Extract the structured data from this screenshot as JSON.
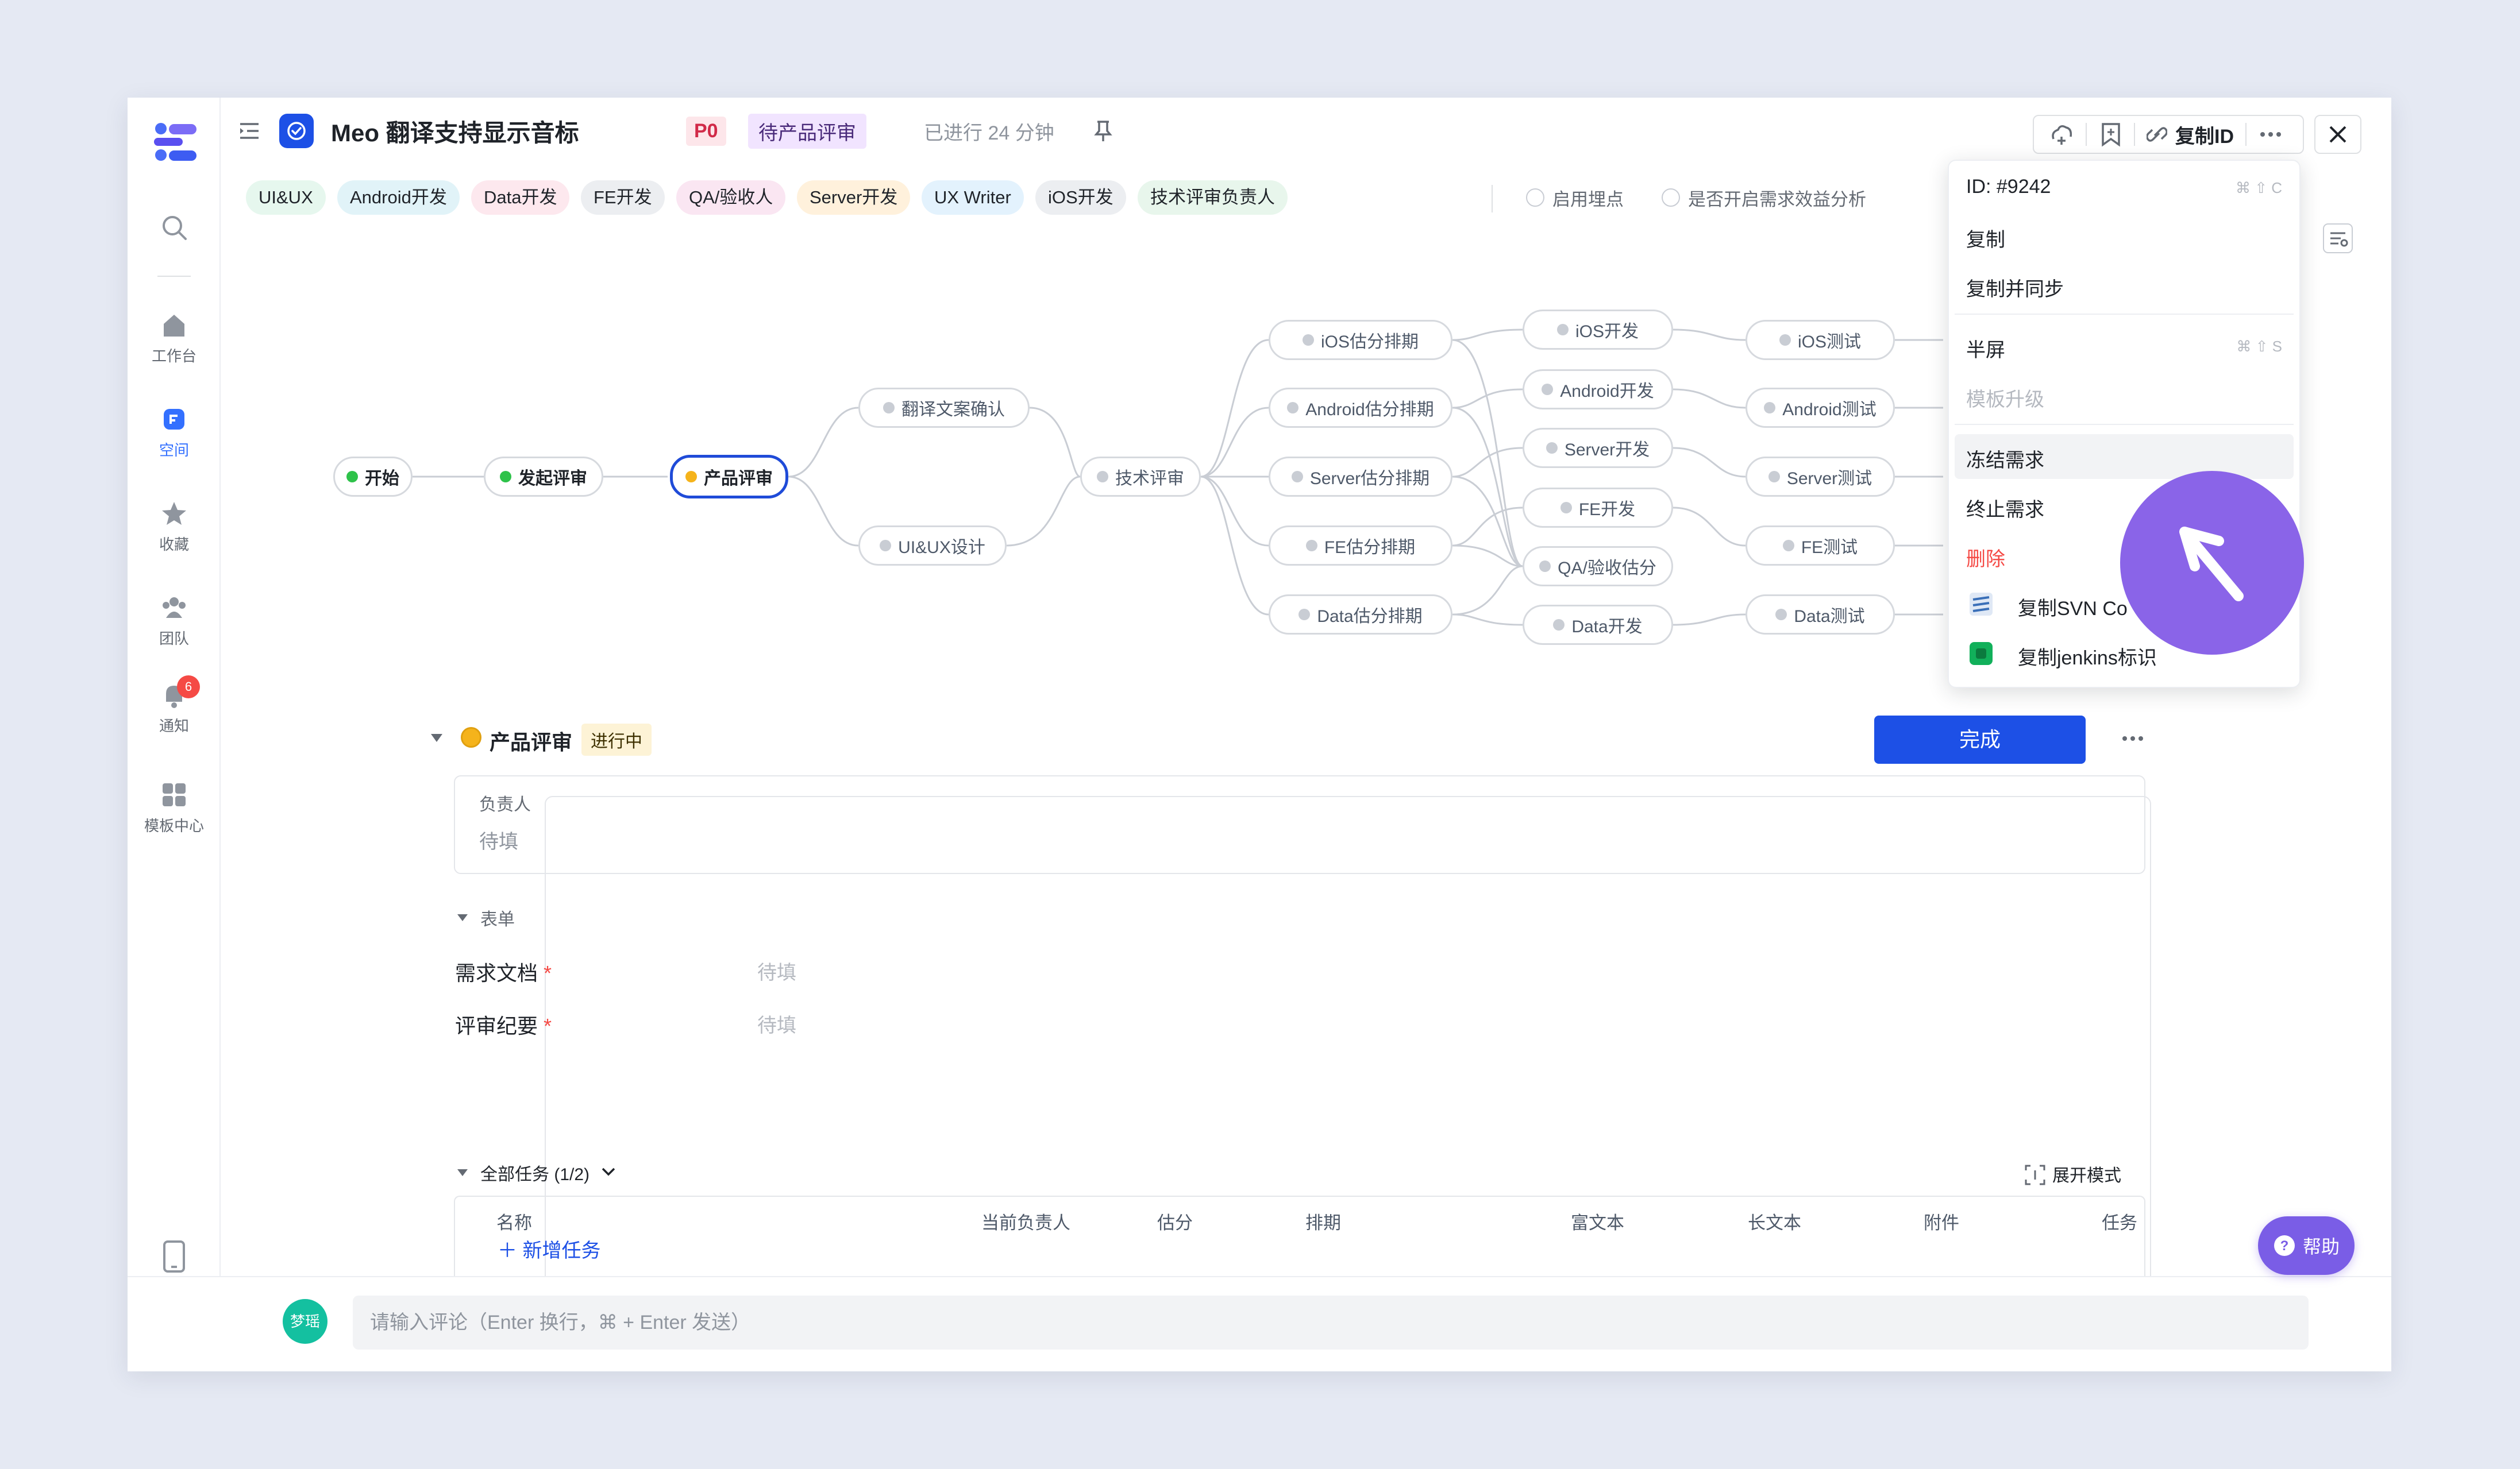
{
  "nav": {
    "items": [
      {
        "label": "工作台",
        "icon": "home-icon"
      },
      {
        "label": "空间",
        "icon": "space-icon"
      },
      {
        "label": "收藏",
        "icon": "star-icon"
      },
      {
        "label": "团队",
        "icon": "team-icon"
      },
      {
        "label": "通知",
        "icon": "bell-icon",
        "badge": "6"
      },
      {
        "label": "模板中心",
        "icon": "template-icon"
      }
    ],
    "user_avatar": "梦瑶"
  },
  "header": {
    "title": "Meo 翻译支持显示音标",
    "priority": "P0",
    "status": "待产品评审",
    "elapsed": "已进行 24 分钟",
    "copy_id_label": "复制ID"
  },
  "chips": [
    {
      "label": "UI&UX",
      "color": "#e6f7ee"
    },
    {
      "label": "Android开发",
      "color": "#e1f3f8"
    },
    {
      "label": "Data开发",
      "color": "#fde8ee"
    },
    {
      "label": "FE开发",
      "color": "#eceef1"
    },
    {
      "label": "QA/验收人",
      "color": "#fae6f2"
    },
    {
      "label": "Server开发",
      "color": "#fff1dc"
    },
    {
      "label": "UX Writer",
      "color": "#e3f2fd"
    },
    {
      "label": "iOS开发",
      "color": "#eceef1"
    },
    {
      "label": "技术评审负责人",
      "color": "#e8f6ec"
    }
  ],
  "toggles": [
    {
      "label": "启用埋点"
    },
    {
      "label": "是否开启需求效益分析"
    }
  ],
  "flow": {
    "nodes": {
      "start": "开始",
      "launch": "发起评审",
      "product": "产品评审",
      "copy_confirm": "翻译文案确认",
      "uiux": "UI&UX设计",
      "tech": "技术评审",
      "ios_est": "iOS估分排期",
      "android_est": "Android估分排期",
      "server_est": "Server估分排期",
      "fe_est": "FE估分排期",
      "data_est": "Data估分排期",
      "ios_dev": "iOS开发",
      "android_dev": "Android开发",
      "server_dev": "Server开发",
      "fe_dev": "FE开发",
      "qa_est": "QA/验收估分",
      "data_dev": "Data开发",
      "ios_test": "iOS测试",
      "android_test": "Android测试",
      "server_test": "Server测试",
      "fe_test": "FE测试",
      "data_test": "Data测试"
    }
  },
  "stage": {
    "name": "产品评审",
    "status": "进行中",
    "complete_label": "完成",
    "assignee_label": "负责人",
    "assignee_value": "待填",
    "form_section": "表单",
    "fields": [
      {
        "label": "需求文档",
        "value": "待填"
      },
      {
        "label": "评审纪要",
        "value": "待填"
      }
    ],
    "tasks_title": "全部任务 (1/2)",
    "expand_label": "展开模式",
    "columns": [
      "名称",
      "当前负责人",
      "估分",
      "排期",
      "富文本",
      "长文本",
      "附件",
      "任务"
    ],
    "add_task": "新增任务"
  },
  "comment": {
    "avatar": "梦瑶",
    "placeholder": "请输入评论（Enter 换行，⌘ + Enter 发送）"
  },
  "menu": {
    "id_label": "ID: #9242",
    "id_shortcut": "⌘ ⇧ C",
    "copy": "复制",
    "copy_sync": "复制并同步",
    "half_screen": "半屏",
    "half_shortcut": "⌘ ⇧ S",
    "template_upgrade": "模板升级",
    "freeze": "冻结需求",
    "terminate": "终止需求",
    "delete": "删除",
    "copy_svn": "复制SVN Co",
    "copy_jenkins": "复制jenkins标识"
  },
  "help_label": "帮助",
  "colors": {
    "accent": "#1d50e6",
    "cursor": "#8a64e8",
    "danger": "#f54a45"
  }
}
